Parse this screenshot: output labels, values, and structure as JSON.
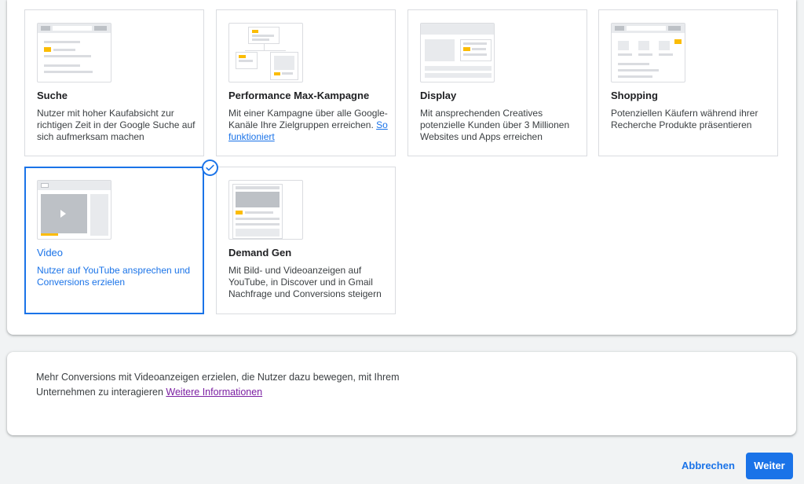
{
  "campaign_types": [
    {
      "key": "search",
      "title": "Suche",
      "description": "Nutzer mit hoher Kaufabsicht zur richtigen Zeit in der Google Suche auf sich aufmerksam machen",
      "selected": false
    },
    {
      "key": "pmax",
      "title": "Performance Max-Kampagne",
      "description": "Mit einer Kampagne über alle Google-Kanäle Ihre Zielgruppen erreichen.",
      "link": "So funktioniert",
      "selected": false
    },
    {
      "key": "display",
      "title": "Display",
      "description": "Mit ansprechenden Creatives potenzielle Kunden über 3 Millionen Websites und Apps erreichen",
      "selected": false
    },
    {
      "key": "shopping",
      "title": "Shopping",
      "description": "Potenziellen Käufern während ihrer Recherche Produkte präsentieren",
      "selected": false
    },
    {
      "key": "video",
      "title": "Video",
      "description": "Nutzer auf YouTube ansprechen und Conversions erzielen",
      "selected": true
    },
    {
      "key": "demand_gen",
      "title": "Demand Gen",
      "description": "Mit Bild- und Videoanzeigen auf YouTube, in Discover und in Gmail Nachfrage und Conversions steigern",
      "selected": false
    }
  ],
  "info": {
    "text": "Mehr Conversions mit Videoanzeigen erzielen, die Nutzer dazu bewegen, mit Ihrem Unternehmen zu interagieren",
    "link": "Weitere Informationen"
  },
  "actions": {
    "cancel": "Abbrechen",
    "next": "Weiter"
  },
  "colors": {
    "accent": "#1a73e8",
    "highlight": "#fbbc04",
    "link_visited": "#7b1fa2"
  }
}
